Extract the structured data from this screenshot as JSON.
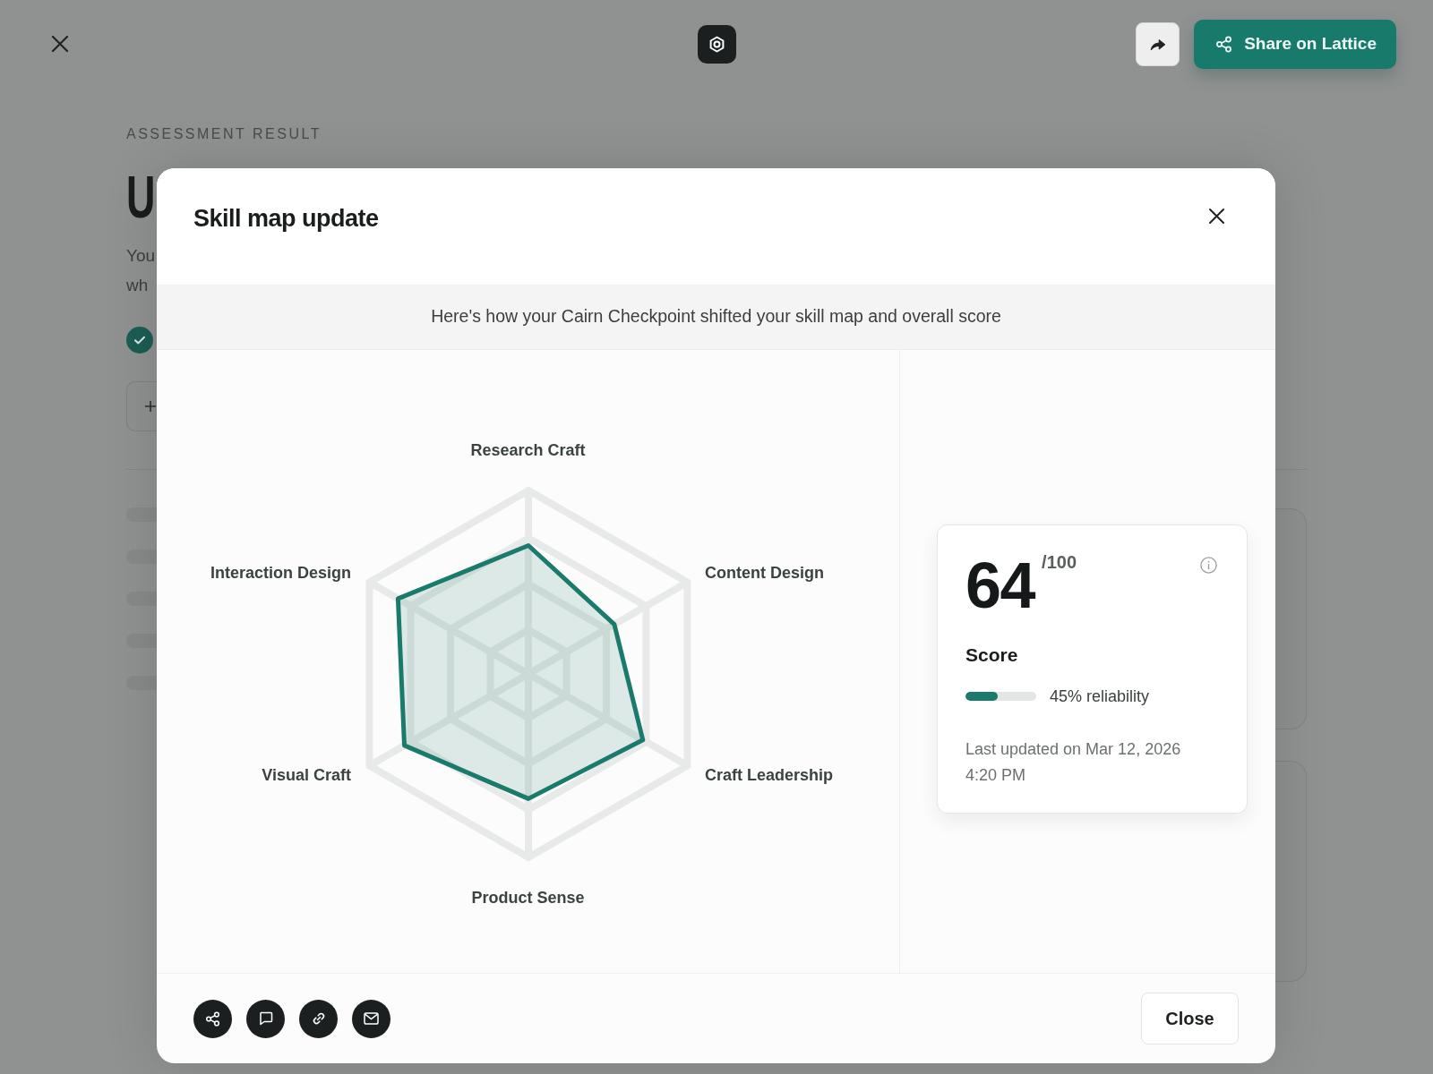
{
  "top_bar": {
    "share_button": {
      "label": "Share on Lattice"
    }
  },
  "page": {
    "eyebrow": "ASSESSMENT RESULT",
    "heading": "U",
    "intro_lines": [
      "You",
      "wh"
    ]
  },
  "modal": {
    "title": "Skill map update",
    "subtitle": "Here's how your Cairn Checkpoint shifted your skill map and overall score",
    "skill_map": {
      "axes": [
        {
          "label": "Research Craft"
        },
        {
          "label": "Content Design"
        },
        {
          "label": "Craft Leadership"
        },
        {
          "label": "Product Sense"
        },
        {
          "label": "Visual Craft"
        },
        {
          "label": "Interaction Design"
        }
      ]
    },
    "score_card": {
      "score": "64",
      "out_of": "/100",
      "label": "Score",
      "reliability": {
        "level": 0.45,
        "reading": "45% reliability"
      },
      "updated": "Last updated on Mar 12, 2026 4:20 PM"
    },
    "footer": {
      "close_button": {
        "label": "Close"
      }
    }
  }
}
